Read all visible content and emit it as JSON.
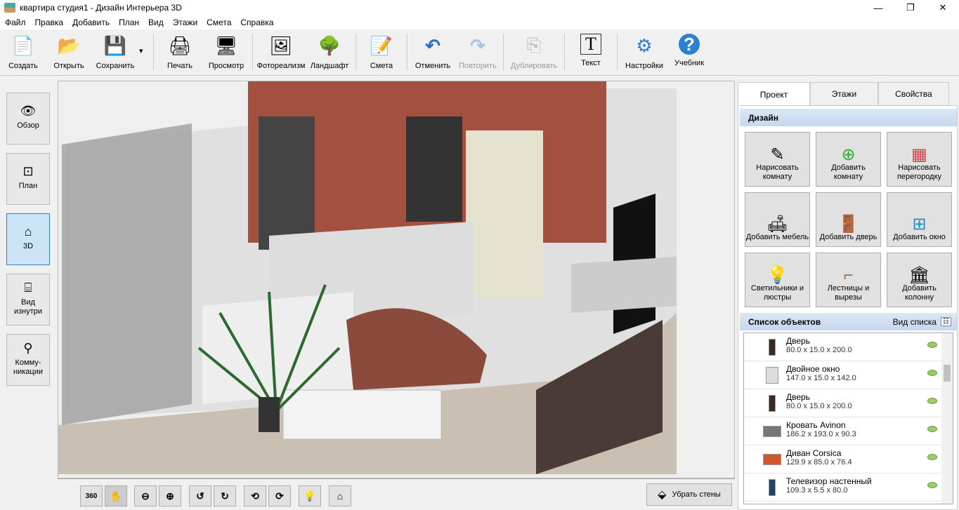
{
  "window": {
    "title": "квартира студия1 - Дизайн Интерьера 3D",
    "min": "—",
    "max": "❐",
    "close": "✕"
  },
  "menu": [
    "Файл",
    "Правка",
    "Добавить",
    "План",
    "Вид",
    "Этажи",
    "Смета",
    "Справка"
  ],
  "toolbar": [
    {
      "label": "Создать",
      "icon": "📄"
    },
    {
      "label": "Открыть",
      "icon": "📂"
    },
    {
      "label": "Сохранить",
      "icon": "💾"
    },
    {
      "label": "Печать",
      "icon": "🖨"
    },
    {
      "label": "Просмотр",
      "icon": "🖥"
    },
    {
      "label": "Фотореализм",
      "icon": "🖼"
    },
    {
      "label": "Ландшафт",
      "icon": "🌳"
    },
    {
      "label": "Смета",
      "icon": "📝"
    },
    {
      "label": "Отменить",
      "icon": "↶"
    },
    {
      "label": "Повторить",
      "icon": "↷"
    },
    {
      "label": "Дублировать",
      "icon": "⎘"
    },
    {
      "label": "Текст",
      "icon": "T"
    },
    {
      "label": "Настройки",
      "icon": "⚙"
    },
    {
      "label": "Учебник",
      "icon": "?"
    }
  ],
  "save_dropdown": "▾",
  "sidebar": [
    {
      "label": "Обзор",
      "icon": "👁"
    },
    {
      "label": "План",
      "icon": "⊡"
    },
    {
      "label": "3D",
      "icon": "⌂"
    },
    {
      "label": "Вид изнутри",
      "icon": "⌸"
    },
    {
      "label": "Комму-никации",
      "icon": "⚲"
    }
  ],
  "bottom": {
    "buttons": [
      "360",
      "✋",
      "⊖",
      "⊕",
      "↺",
      "↻",
      "⟲",
      "⟳",
      "💡",
      "⌂"
    ],
    "remove_walls": "Убрать стены"
  },
  "tabs": [
    "Проект",
    "Этажи",
    "Свойства"
  ],
  "design": {
    "title": "Дизайн",
    "buttons": [
      {
        "label": "Нарисовать комнату",
        "icon": "✎"
      },
      {
        "label": "Добавить комнату",
        "icon": "⊕"
      },
      {
        "label": "Нарисовать перегородку",
        "icon": "▦"
      },
      {
        "label": "Добавить мебель",
        "icon": "🛋"
      },
      {
        "label": "Добавить дверь",
        "icon": "🚪"
      },
      {
        "label": "Добавить окно",
        "icon": "⊞"
      },
      {
        "label": "Светильники и люстры",
        "icon": "💡"
      },
      {
        "label": "Лестницы и вырезы",
        "icon": "⌐"
      },
      {
        "label": "Добавить колонну",
        "icon": "🏛"
      }
    ]
  },
  "objects": {
    "title": "Список объектов",
    "view_label": "Вид списка",
    "items": [
      {
        "name": "Дверь",
        "dims": "80.0 x 15.0 x 200.0",
        "color": "#3a2a22"
      },
      {
        "name": "Двойное окно",
        "dims": "147.0 x 15.0 x 142.0",
        "color": "#ddd"
      },
      {
        "name": "Дверь",
        "dims": "80.0 x 15.0 x 200.0",
        "color": "#3a2a22"
      },
      {
        "name": "Кровать Avinon",
        "dims": "186.2 x 193.0 x 90.3",
        "color": "#777"
      },
      {
        "name": "Диван Corsica",
        "dims": "129.9 x 85.0 x 76.4",
        "color": "#d2552e"
      },
      {
        "name": "Телевизор настенный",
        "dims": "109.3 x 5.5 x 80.0",
        "color": "#246"
      }
    ]
  }
}
